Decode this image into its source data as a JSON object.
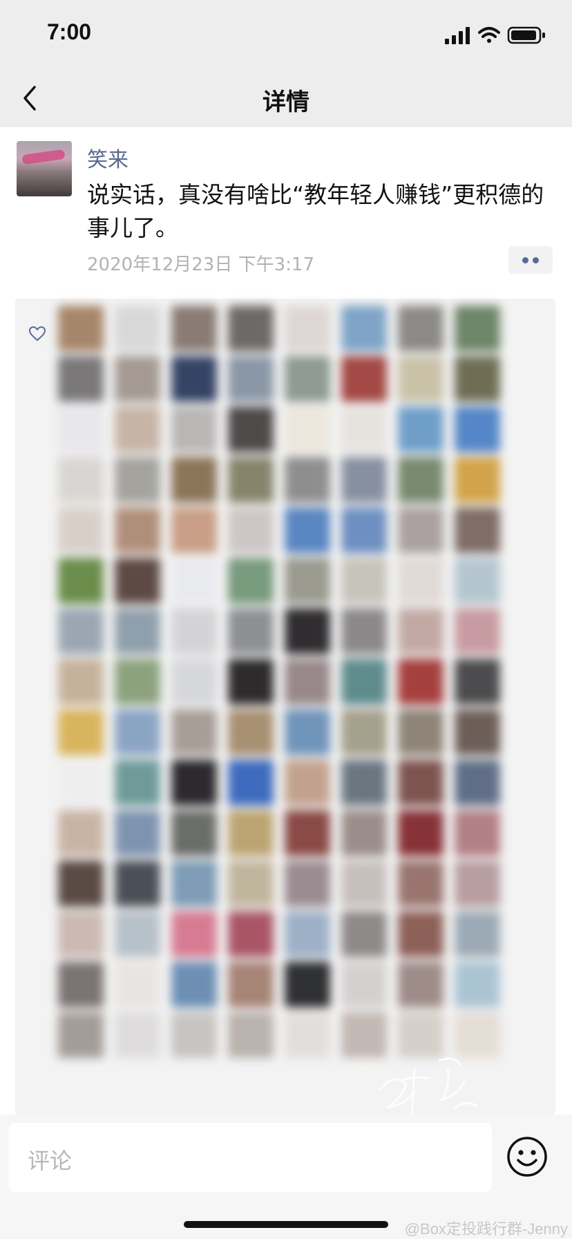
{
  "status_bar": {
    "time": "7:00"
  },
  "navbar": {
    "title": "详情"
  },
  "post": {
    "username": "笑来",
    "text": "说实话，真没有啥比“教年轻人赚钱”更积德的事儿了。",
    "timestamp": "2020年12月23日 下午3:17"
  },
  "likes": {
    "avatar_colors": [
      "#a6866a",
      "#d8d8d8",
      "#8a7b73",
      "#6d6966",
      "#ddd6d4",
      "#7fa4c7",
      "#8c8a87",
      "#6e8569",
      "#7a7878",
      "#a49a93",
      "#354465",
      "#8a97a6",
      "#8e9a92",
      "#a34845",
      "#c9c2a8",
      "#6f6e55",
      "#e7e7ec",
      "#c6b4a6",
      "#b9b6b5",
      "#4f4a4a",
      "#ece6dc",
      "#e6e3de",
      "#6f9ec9",
      "#5586c7",
      "#d9d5d2",
      "#a4a39e",
      "#8b7559",
      "#86846b",
      "#8f8e8e",
      "#8790a0",
      "#778a70",
      "#d2a34b",
      "#d8cfc9",
      "#b08f7a",
      "#c89e86",
      "#cdc6c6",
      "#5a86c2",
      "#6d8fc1",
      "#aaa1a0",
      "#7f6d66",
      "#6a8d4b",
      "#5e4a45",
      "#e9eaee",
      "#789a7d",
      "#9a9a8f",
      "#c5c3ba",
      "#e0dad6",
      "#b4c5d0",
      "#9aa7b3",
      "#8f9fab",
      "#d3d3d6",
      "#8d8f92",
      "#2f2d30",
      "#8b888a",
      "#c2a9a4",
      "#c79ba1",
      "#c6b29b",
      "#8ba27d",
      "#d6d7db",
      "#2e2b2c",
      "#98888a",
      "#5f8b8d",
      "#a5403e",
      "#4c4c4e",
      "#d9b45e",
      "#8aa4c4",
      "#a89e98",
      "#a78f71",
      "#6f94ba",
      "#a5a08c",
      "#8e8477",
      "#6d5f58",
      "#eeeeee",
      "#6f9a9a",
      "#2c2a2e",
      "#3e6bbd",
      "#c2a28e",
      "#6a7680",
      "#7e5450",
      "#5f6e86",
      "#c9b3a4",
      "#7e93b0",
      "#6b6d6a",
      "#bca472",
      "#8a4a46",
      "#9a8e8a",
      "#873236",
      "#b27f86",
      "#5a4a44",
      "#4b5058",
      "#7e9cb5",
      "#c0b69e",
      "#9a8b91",
      "#c7bfbc",
      "#9a756f",
      "#b79da0",
      "#cbb9b2",
      "#b7c1c9",
      "#d77b93",
      "#a95566",
      "#9db0c6",
      "#8e8a89",
      "#8d6058",
      "#9baab6",
      "#7b7472",
      "#e8e4e2",
      "#6d8fb4",
      "#a68476",
      "#2f3032",
      "#d4d0cf",
      "#9e8c89",
      "#abc4d4",
      "#a49c98",
      "#dedcdc",
      "#c7c4c2",
      "#b9b2ad",
      "#e2dedb",
      "#c2b8b4",
      "#d6cfc9",
      "#e4ddd6"
    ]
  },
  "comment_bar": {
    "placeholder": "评论",
    "source_watermark": "@Box定投践行群-Jenny"
  }
}
